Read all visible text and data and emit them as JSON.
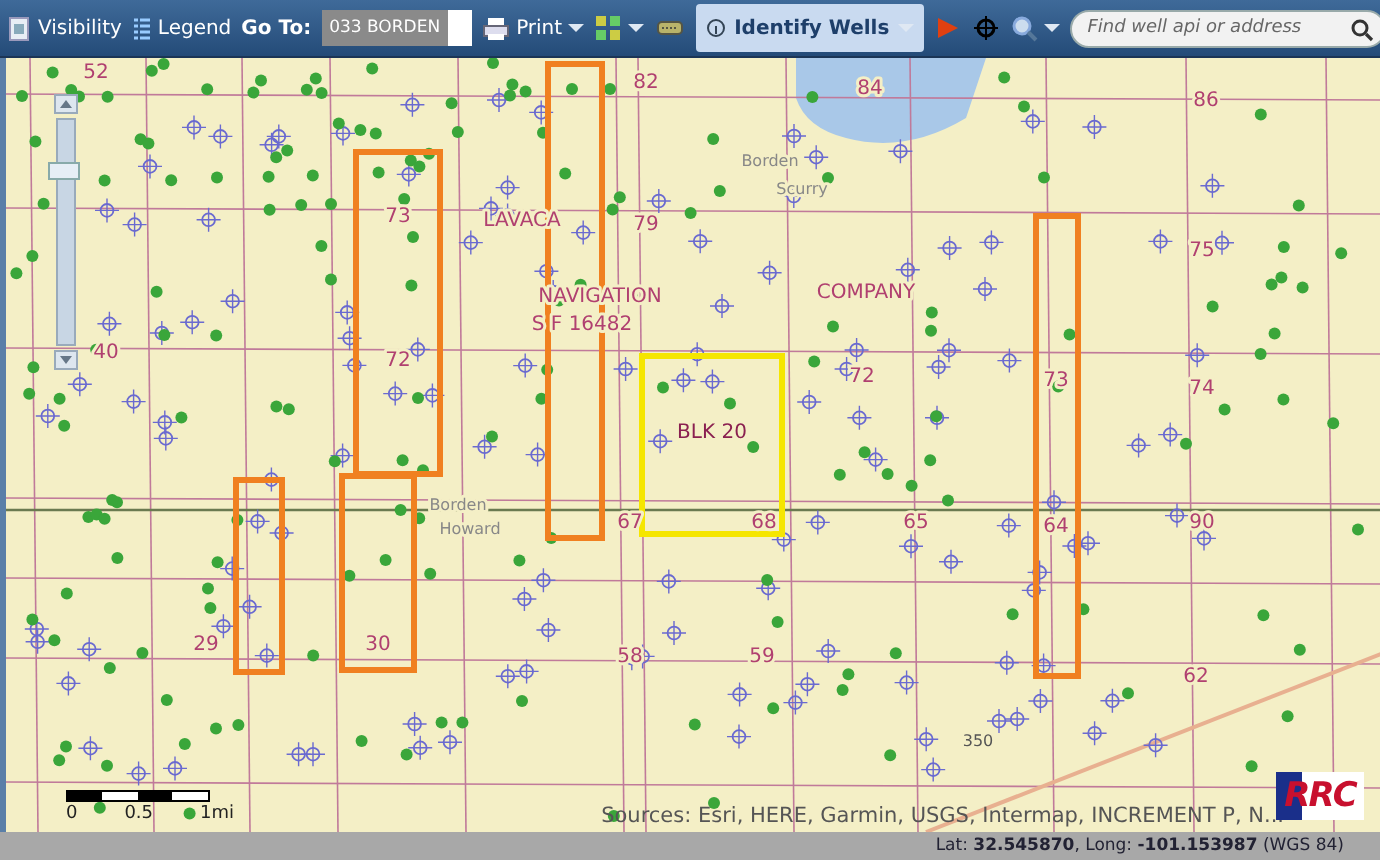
{
  "toolbar": {
    "visibility": "Visibility",
    "legend": "Legend",
    "goto_label": "Go To:",
    "goto_value": "033 BORDEN",
    "print": "Print",
    "identify": {
      "label": "Identify Wells",
      "selected": true
    },
    "search": {
      "placeholder": "Find well api or address"
    }
  },
  "map": {
    "zoom": {
      "level": 0.8
    },
    "labels": [
      {
        "text": "52",
        "kind": "section"
      },
      {
        "text": "82",
        "kind": "section"
      },
      {
        "text": "84",
        "kind": "section"
      },
      {
        "text": "86",
        "kind": "section"
      },
      {
        "text": "73",
        "kind": "section"
      },
      {
        "text": "79",
        "kind": "section"
      },
      {
        "text": "75",
        "kind": "section"
      },
      {
        "text": "40",
        "kind": "section"
      },
      {
        "text": "72",
        "kind": "section"
      },
      {
        "text": "72",
        "kind": "section"
      },
      {
        "text": "73",
        "kind": "section"
      },
      {
        "text": "74",
        "kind": "section"
      },
      {
        "text": "67",
        "kind": "section"
      },
      {
        "text": "68",
        "kind": "section"
      },
      {
        "text": "65",
        "kind": "section"
      },
      {
        "text": "64",
        "kind": "section"
      },
      {
        "text": "90",
        "kind": "section"
      },
      {
        "text": "29",
        "kind": "section"
      },
      {
        "text": "30",
        "kind": "section"
      },
      {
        "text": "58",
        "kind": "section"
      },
      {
        "text": "59",
        "kind": "section"
      },
      {
        "text": "62",
        "kind": "section"
      },
      {
        "text": "LAVACA",
        "kind": "survey"
      },
      {
        "text": "NAVIGATION",
        "kind": "survey"
      },
      {
        "text": "COMPANY",
        "kind": "survey"
      },
      {
        "text": "S F 16482",
        "kind": "survey"
      },
      {
        "text": "BLK 20",
        "kind": "block"
      },
      {
        "text": "Borden",
        "kind": "county"
      },
      {
        "text": "Scurry",
        "kind": "county"
      },
      {
        "text": "Borden",
        "kind": "county"
      },
      {
        "text": "Howard",
        "kind": "county"
      },
      {
        "text": "350",
        "kind": "road"
      }
    ],
    "frames": [
      {
        "color": "#f08020"
      },
      {
        "color": "#f08020"
      },
      {
        "color": "#f08020"
      },
      {
        "color": "#f08020"
      },
      {
        "color": "#f08020"
      },
      {
        "color": "#f5e600"
      }
    ],
    "scale": {
      "ticks": [
        "0",
        "0.5",
        "1mi"
      ]
    },
    "attribution": "Sources: Esri, HERE, Garmin, USGS, Intermap, INCREMENT P, N...",
    "logo": "RRC"
  },
  "status_bar": {
    "coordinates": "Lat: **32.545870**, Long: **-101.153987** (WGS 84)"
  }
}
